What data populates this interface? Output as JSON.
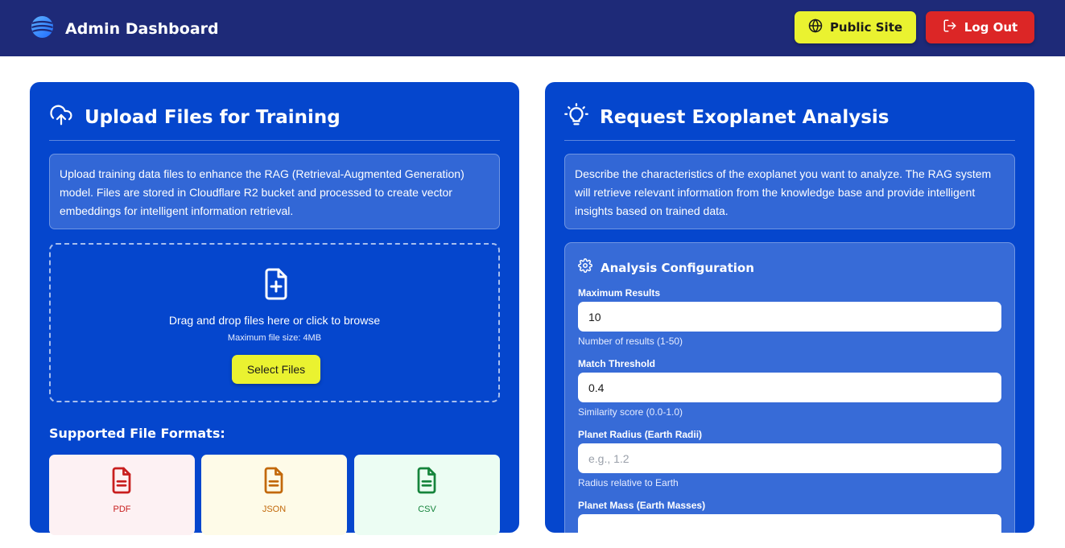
{
  "header": {
    "title": "Admin Dashboard",
    "public_site_label": "Public Site",
    "logout_label": "Log Out",
    "bg_color": "#1e2a78"
  },
  "upload_panel": {
    "title": "Upload Files for Training",
    "description": "Upload training data files to enhance the RAG (Retrieval-Augmented Generation) model. Files are stored in Cloudflare R2 bucket and processed to create vector embeddings for intelligent information retrieval.",
    "dropzone": {
      "text": "Drag and drop files here or click to browse",
      "max_size": "Maximum file size: 4MB",
      "select_label": "Select Files"
    },
    "formats_title": "Supported File Formats:",
    "formats": [
      {
        "label": "PDF",
        "icon": "file-text-icon",
        "color": "#c81e1e"
      },
      {
        "label": "JSON",
        "icon": "file-text-icon",
        "color": "#c2680a"
      },
      {
        "label": "CSV",
        "icon": "file-text-icon",
        "color": "#16843c"
      }
    ]
  },
  "analysis_panel": {
    "title": "Request Exoplanet Analysis",
    "description": "Describe the characteristics of the exoplanet you want to analyze. The RAG system will retrieve relevant information from the knowledge base and provide intelligent insights based on trained data.",
    "config": {
      "title": "Analysis Configuration",
      "fields": [
        {
          "label": "Maximum Results",
          "value": "10",
          "placeholder": "",
          "help": "Number of results (1-50)"
        },
        {
          "label": "Match Threshold",
          "value": "0.4",
          "placeholder": "",
          "help": "Similarity score (0.0-1.0)"
        },
        {
          "label": "Planet Radius (Earth Radii)",
          "value": "",
          "placeholder": "e.g., 1.2",
          "help": "Radius relative to Earth"
        },
        {
          "label": "Planet Mass (Earth Masses)",
          "value": "",
          "placeholder": "",
          "help": ""
        }
      ]
    }
  },
  "colors": {
    "panel_bg": "#0546cd",
    "accent_yellow": "#eaf230",
    "danger_red": "#dc2626"
  }
}
